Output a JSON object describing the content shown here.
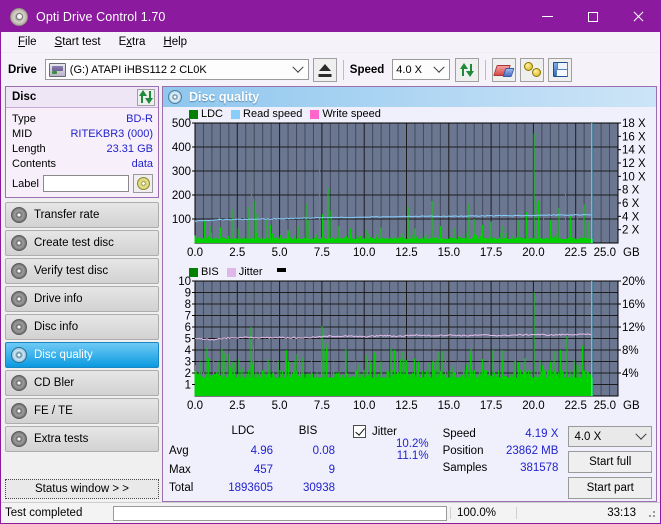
{
  "window": {
    "title": "Opti Drive Control 1.70",
    "icon": "disc-icon",
    "accent_purple": "#8B1A9E",
    "minimize": "–",
    "maximize": "□",
    "close": "✕"
  },
  "menu": {
    "items": [
      {
        "label": "File",
        "accel": "F"
      },
      {
        "label": "Start test",
        "accel": "S"
      },
      {
        "label": "Extra",
        "accel": "x"
      },
      {
        "label": "Help",
        "accel": "H"
      }
    ]
  },
  "toolbar": {
    "drive_label": "Drive",
    "drive_value": "(G:)   ATAPI iHBS112   2 CL0K",
    "eject_icon": "eject-icon",
    "speed_label": "Speed",
    "speed_value": "4.0 X",
    "refresh_icon": "refresh-icon",
    "erase_icon": "erase-icon",
    "coins_icon": "coins-icon",
    "save_icon": "save-icon"
  },
  "disc_panel": {
    "title": "Disc",
    "refresh_icon": "refresh-icon",
    "rows": [
      {
        "key": "Type",
        "value": "BD-R"
      },
      {
        "key": "MID",
        "value": "RITEKBR3 (000)"
      },
      {
        "key": "Length",
        "value": "23.31 GB"
      },
      {
        "key": "Contents",
        "value": "data"
      }
    ],
    "label_key": "Label",
    "label_value": "",
    "label_placeholder": "",
    "disc_icon": "cd-icon"
  },
  "nav": {
    "items": [
      {
        "label": "Transfer rate",
        "icon": "disc-icon",
        "active": false
      },
      {
        "label": "Create test disc",
        "icon": "disc-icon",
        "active": false
      },
      {
        "label": "Verify test disc",
        "icon": "disc-icon",
        "active": false
      },
      {
        "label": "Drive info",
        "icon": "disc-icon",
        "active": false
      },
      {
        "label": "Disc info",
        "icon": "disc-icon",
        "active": false
      },
      {
        "label": "Disc quality",
        "icon": "disc-icon",
        "active": true
      },
      {
        "label": "CD Bler",
        "icon": "disc-icon",
        "active": false
      },
      {
        "label": "FE / TE",
        "icon": "disc-icon",
        "active": false
      },
      {
        "label": "Extra tests",
        "icon": "disc-icon",
        "active": false
      }
    ],
    "status_window": "Status window > >"
  },
  "content": {
    "header": "Disc quality",
    "header_icon": "disc-quality-icon"
  },
  "chart_data": [
    {
      "id": "ldc-chart",
      "type": "line",
      "title": "",
      "xlabel": "GB",
      "ylabel": "",
      "xlim": [
        0,
        25.0
      ],
      "ylim": [
        0,
        500
      ],
      "y2lim": [
        0,
        18
      ],
      "y2label": "X",
      "xticks": [
        "0.0",
        "2.5",
        "5.0",
        "7.5",
        "10.0",
        "12.5",
        "15.0",
        "17.5",
        "20.0",
        "22.5",
        "25.0"
      ],
      "yticks": [
        "100",
        "200",
        "300",
        "400",
        "500"
      ],
      "y2ticks": [
        "2 X",
        "4 X",
        "6 X",
        "8 X",
        "10 X",
        "12 X",
        "14 X",
        "16 X",
        "18 X"
      ],
      "grid": true,
      "plot_bg": "#6b7691",
      "legend_position": "top-left",
      "legend": [
        {
          "name": "LDC",
          "color": "#00a000"
        },
        {
          "name": "Read speed",
          "color": "#87cefa"
        },
        {
          "name": "Write speed",
          "color": "#ff66cc"
        }
      ],
      "series": [
        {
          "name": "LDC",
          "color": "#00d000",
          "kind": "impulse",
          "data_end_gb": 23.5,
          "baseline": 20,
          "peaks": [
            [
              0.55,
              95
            ],
            [
              0.9,
              70
            ],
            [
              1.45,
              110
            ],
            [
              1.5,
              65
            ],
            [
              2.25,
              140
            ],
            [
              2.55,
              60
            ],
            [
              3.2,
              150
            ],
            [
              3.35,
              250
            ],
            [
              3.45,
              185
            ],
            [
              3.55,
              175
            ],
            [
              3.65,
              120
            ],
            [
              4.25,
              95
            ],
            [
              4.45,
              75
            ],
            [
              5.1,
              60
            ],
            [
              5.5,
              55
            ],
            [
              6.1,
              70
            ],
            [
              6.55,
              165
            ],
            [
              6.75,
              95
            ],
            [
              7.35,
              345
            ],
            [
              7.55,
              120
            ],
            [
              7.85,
              230
            ],
            [
              8.05,
              135
            ],
            [
              8.5,
              70
            ],
            [
              9.2,
              60
            ],
            [
              10.1,
              55
            ],
            [
              11.0,
              65
            ],
            [
              12.2,
              70
            ],
            [
              12.6,
              150
            ],
            [
              13.0,
              60
            ],
            [
              14.0,
              175
            ],
            [
              14.5,
              70
            ],
            [
              15.3,
              60
            ],
            [
              16.2,
              165
            ],
            [
              16.5,
              100
            ],
            [
              17.0,
              75
            ],
            [
              17.5,
              90
            ],
            [
              18.2,
              70
            ],
            [
              19.1,
              95
            ],
            [
              19.6,
              130
            ],
            [
              20.05,
              457
            ],
            [
              20.3,
              175
            ],
            [
              20.6,
              120
            ],
            [
              21.0,
              95
            ],
            [
              21.5,
              145
            ],
            [
              21.9,
              230
            ],
            [
              22.2,
              110
            ],
            [
              22.6,
              120
            ],
            [
              23.0,
              160
            ],
            [
              23.3,
              90
            ]
          ]
        },
        {
          "name": "Read speed",
          "color": "#87cefa",
          "kind": "line",
          "points": [
            [
              0.0,
              3.3
            ],
            [
              1.5,
              3.5
            ],
            [
              3.0,
              3.55
            ],
            [
              4.5,
              3.6
            ],
            [
              6.0,
              3.7
            ],
            [
              7.5,
              3.8
            ],
            [
              9.0,
              3.85
            ],
            [
              10.5,
              3.9
            ],
            [
              12.0,
              3.95
            ],
            [
              13.5,
              4.0
            ],
            [
              15.0,
              4.0
            ],
            [
              16.5,
              4.05
            ],
            [
              18.0,
              4.1
            ],
            [
              19.5,
              4.1
            ],
            [
              21.0,
              4.2
            ],
            [
              22.5,
              4.2
            ],
            [
              23.4,
              4.2
            ]
          ],
          "cursor_gb": 23.45
        }
      ]
    },
    {
      "id": "bis-jitter-chart",
      "type": "line",
      "title": "",
      "xlabel": "GB",
      "ylabel": "",
      "xlim": [
        0,
        25.0
      ],
      "ylim": [
        0,
        10
      ],
      "y2lim": [
        0,
        20
      ],
      "y2label": "%",
      "xticks": [
        "0.0",
        "2.5",
        "5.0",
        "7.5",
        "10.0",
        "12.5",
        "15.0",
        "17.5",
        "20.0",
        "22.5",
        "25.0"
      ],
      "yticks": [
        "1",
        "2",
        "3",
        "4",
        "5",
        "6",
        "7",
        "8",
        "9",
        "10"
      ],
      "y2ticks": [
        "4%",
        "8%",
        "12%",
        "16%",
        "20%"
      ],
      "grid": true,
      "plot_bg": "#6b7691",
      "legend_position": "top-left",
      "legend": [
        {
          "name": "BIS",
          "color": "#00a000"
        },
        {
          "name": "Jitter",
          "color": "#e0b8e8"
        }
      ],
      "series": [
        {
          "name": "BIS",
          "color": "#00d000",
          "kind": "impulse",
          "data_end_gb": 23.5,
          "baseline": 1.9,
          "peaks": [
            [
              0.3,
              3.0
            ],
            [
              0.7,
              4.2
            ],
            [
              1.1,
              3.1
            ],
            [
              1.35,
              3.0
            ],
            [
              1.6,
              4.1
            ],
            [
              2.2,
              3.0
            ],
            [
              2.6,
              3.2
            ],
            [
              3.3,
              6.0
            ],
            [
              3.45,
              4.4
            ],
            [
              3.8,
              3.0
            ],
            [
              4.3,
              3.2
            ],
            [
              4.9,
              3.0
            ],
            [
              5.4,
              4.0
            ],
            [
              5.9,
              3.1
            ],
            [
              6.4,
              3.0
            ],
            [
              6.9,
              3.3
            ],
            [
              7.5,
              6.1
            ],
            [
              7.8,
              4.6
            ],
            [
              8.2,
              3.0
            ],
            [
              8.9,
              3.1
            ],
            [
              9.5,
              3.0
            ],
            [
              10.2,
              3.2
            ],
            [
              11.0,
              3.0
            ],
            [
              11.8,
              4.0
            ],
            [
              12.5,
              3.1
            ],
            [
              13.2,
              3.0
            ],
            [
              14.1,
              4.0
            ],
            [
              14.8,
              3.2
            ],
            [
              15.5,
              3.0
            ],
            [
              16.3,
              4.1
            ],
            [
              17.0,
              3.2
            ],
            [
              17.6,
              4.0
            ],
            [
              18.2,
              3.1
            ],
            [
              18.9,
              3.0
            ],
            [
              19.5,
              3.3
            ],
            [
              20.05,
              9.0
            ],
            [
              20.4,
              3.1
            ],
            [
              21.0,
              3.0
            ],
            [
              21.6,
              4.0
            ],
            [
              22.0,
              5.2
            ],
            [
              22.4,
              3.1
            ],
            [
              22.9,
              4.4
            ],
            [
              23.2,
              3.0
            ]
          ]
        },
        {
          "name": "Jitter",
          "color": "#e5bde8",
          "kind": "line",
          "avg_percent": 10.2,
          "points": [
            [
              0.0,
              5.0
            ],
            [
              1.0,
              4.9
            ],
            [
              2.0,
              5.05
            ],
            [
              3.0,
              5.1
            ],
            [
              4.0,
              5.05
            ],
            [
              5.0,
              5.1
            ],
            [
              6.0,
              5.05
            ],
            [
              7.0,
              5.1
            ],
            [
              8.0,
              5.2
            ],
            [
              9.0,
              5.2
            ],
            [
              10.0,
              5.15
            ],
            [
              11.0,
              5.25
            ],
            [
              12.0,
              5.2
            ],
            [
              13.0,
              5.3
            ],
            [
              14.0,
              5.25
            ],
            [
              15.0,
              5.3
            ],
            [
              16.0,
              5.25
            ],
            [
              17.0,
              5.3
            ],
            [
              18.0,
              5.25
            ],
            [
              19.0,
              5.3
            ],
            [
              20.0,
              5.35
            ],
            [
              21.0,
              5.3
            ],
            [
              22.0,
              5.35
            ],
            [
              23.3,
              5.35
            ]
          ],
          "cursor_gb": 23.45
        }
      ]
    }
  ],
  "stats": {
    "col_headers": [
      "",
      "LDC",
      "BIS"
    ],
    "rows": [
      {
        "label": "Avg",
        "ldc": "4.96",
        "bis": "0.08"
      },
      {
        "label": "Max",
        "ldc": "457",
        "bis": "9"
      },
      {
        "label": "Total",
        "ldc": "1893605",
        "bis": "30938"
      }
    ],
    "jitter": {
      "checked": true,
      "label": "Jitter",
      "avg": "10.2%",
      "max": "11.1%"
    },
    "speed_label": "Speed",
    "speed_value": "4.19 X",
    "position_label": "Position",
    "position_value": "23862 MB",
    "samples_label": "Samples",
    "samples_value": "381578",
    "speed_select": "4.0 X",
    "start_full": "Start full",
    "start_part": "Start part"
  },
  "statusbar": {
    "message": "Test completed",
    "progress_percent": 100.0,
    "progress_text": "100.0%",
    "elapsed": "33:13"
  }
}
